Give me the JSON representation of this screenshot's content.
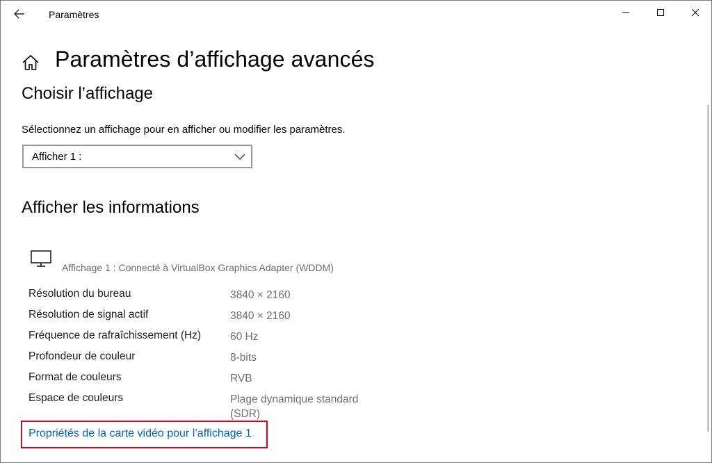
{
  "window": {
    "app_title": "Paramètres"
  },
  "header": {
    "page_title": "Paramètres d’affichage avancés"
  },
  "choose_display": {
    "title": "Choisir l’affichage",
    "description": "Sélectionnez un affichage pour en afficher ou modifier les paramètres.",
    "selected": "Afficher 1 :"
  },
  "display_info": {
    "title": "Afficher les informations",
    "adapter": "Affichage 1 : Connecté à VirtualBox Graphics Adapter (WDDM)",
    "rows": [
      {
        "label": "Résolution du bureau",
        "value": "3840 × 2160"
      },
      {
        "label": "Résolution de signal actif",
        "value": "3840 × 2160"
      },
      {
        "label": "Fréquence de rafraîchissement (Hz)",
        "value": "60 Hz"
      },
      {
        "label": "Profondeur de couleur",
        "value": "8-bits"
      },
      {
        "label": "Format de couleurs",
        "value": "RVB"
      },
      {
        "label": "Espace de couleurs",
        "value": "Plage dynamique standard (SDR)"
      }
    ],
    "adapter_link": "Propriétés de la carte vidéo pour l’affichage 1"
  },
  "colors": {
    "link": "#0063b1",
    "highlight": "#e0001a"
  },
  "icons": {
    "back": "back-arrow-icon",
    "home": "home-icon",
    "monitor": "monitor-icon",
    "chevron": "chevron-down-icon"
  }
}
